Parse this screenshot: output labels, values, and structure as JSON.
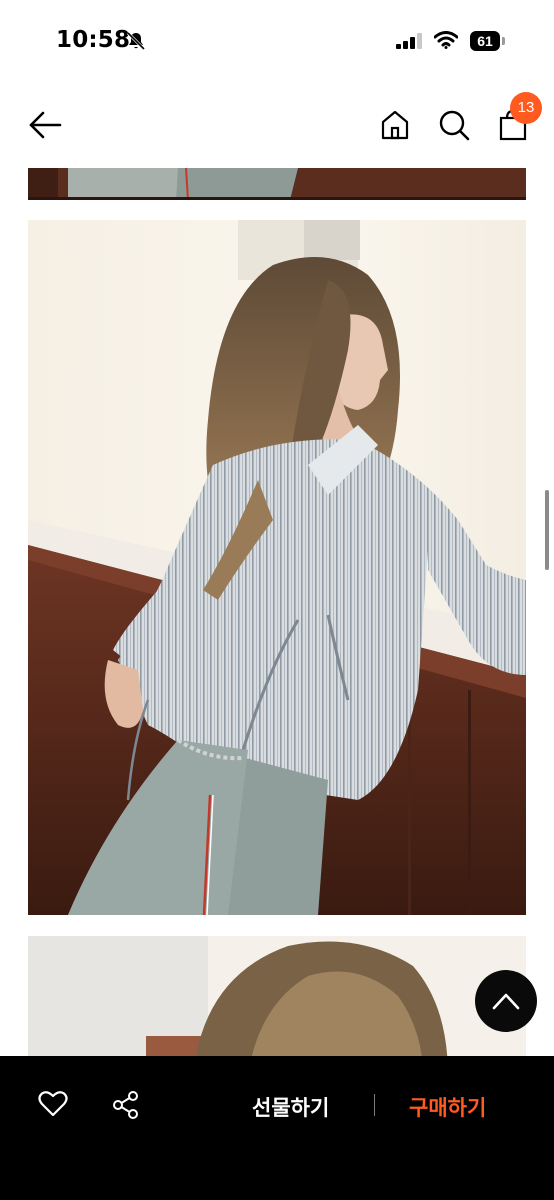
{
  "status_bar": {
    "time": "10:58",
    "battery": "61"
  },
  "header": {
    "cart_count": "13"
  },
  "bottom_bar": {
    "gift_label": "선물하기",
    "buy_label": "구매하기"
  },
  "colors": {
    "accent": "#ff5a1f",
    "bottom_bar_bg": "#000000"
  },
  "icons": [
    "bell-slash-icon",
    "signal-icon",
    "wifi-icon",
    "battery-icon",
    "back-arrow-icon",
    "home-icon",
    "search-icon",
    "shopping-bag-icon",
    "scroll-to-top-icon",
    "heart-icon",
    "share-icon"
  ]
}
